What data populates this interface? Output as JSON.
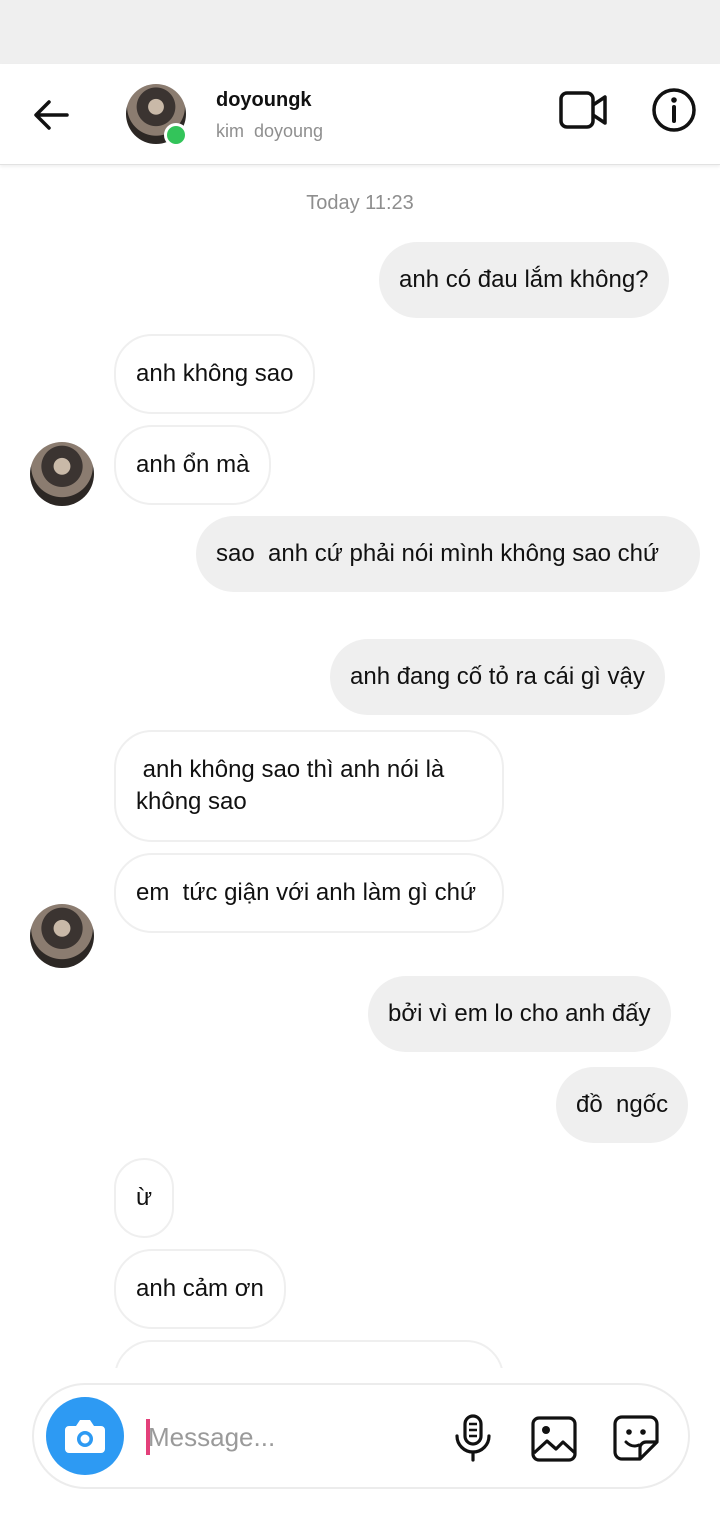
{
  "header": {
    "username": "doyoungk",
    "fullname": "kim  doyoung"
  },
  "thread": {
    "timestamp": "Today 11:23",
    "messages": [
      {
        "sender": "me",
        "text": "anh có đau lắm không?"
      },
      {
        "sender": "them",
        "text": "anh không sao"
      },
      {
        "sender": "them",
        "text": "anh ổn mà"
      },
      {
        "sender": "me",
        "text": "sao  anh cứ phải nói mình không sao chứ"
      },
      {
        "sender": "me",
        "text": "anh đang cố tỏ ra cái gì vậy"
      },
      {
        "sender": "them",
        "text": " anh không sao thì anh nói là không sao"
      },
      {
        "sender": "them",
        "text": "em  tức giận với anh làm gì chứ"
      },
      {
        "sender": "me",
        "text": "bởi vì em lo cho anh đấy"
      },
      {
        "sender": "me",
        "text": "đồ  ngốc"
      },
      {
        "sender": "them",
        "text": "ừ"
      },
      {
        "sender": "them",
        "text": "anh cảm ơn"
      }
    ]
  },
  "composer": {
    "placeholder": "Message..."
  },
  "colors": {
    "accent": "#2d9af3",
    "online": "#33c45a",
    "outgoing_bubble": "#efefef",
    "cursor": "#e3407a"
  },
  "icons": {
    "back": "arrow-left-icon",
    "video": "video-camera-icon",
    "info": "info-icon",
    "camera": "camera-icon",
    "mic": "microphone-icon",
    "gallery": "image-icon",
    "sticker": "sticker-icon"
  }
}
